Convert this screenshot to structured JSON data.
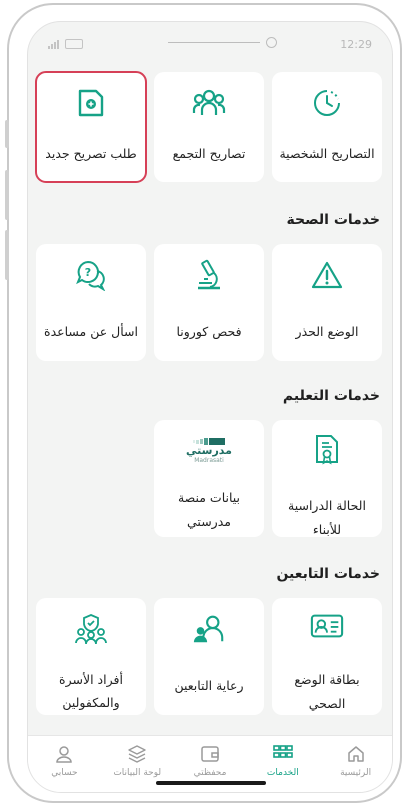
{
  "status": {
    "time": "12:29"
  },
  "colors": {
    "accent": "#16a287",
    "highlight": "#d64057",
    "background": "#f3f4f3"
  },
  "top_row": [
    {
      "label": "التصاريح الشخصية",
      "icon": "clock-icon"
    },
    {
      "label": "تصاريح التجمع",
      "icon": "group-icon"
    },
    {
      "label": "طلب تصريح جديد",
      "icon": "new-document-icon"
    }
  ],
  "health": {
    "title": "خدمات الصحة",
    "items": [
      {
        "label": "الوضع الحذر",
        "icon": "warning-icon"
      },
      {
        "label": "فحص كورونا",
        "icon": "microscope-icon"
      },
      {
        "label": "اسأل عن مساعدة",
        "icon": "help-chat-icon"
      }
    ]
  },
  "education": {
    "title": "خدمات التعليم",
    "items": [
      {
        "label": "الحالة الدراسية للأبناء",
        "icon": "certificate-icon"
      },
      {
        "label": "بيانات منصة مدرستي",
        "icon": "madrasati-logo"
      }
    ],
    "logo_text": "مدرستي",
    "logo_subtext": "Madrasati"
  },
  "dependents": {
    "title": "خدمات التابعين",
    "items": [
      {
        "label": "بطاقة الوضع الصحي",
        "icon": "id-card-icon"
      },
      {
        "label": "رعاية التابعين",
        "icon": "dependents-icon"
      },
      {
        "label": "أفراد الأسرة والمكفولين",
        "icon": "family-shield-icon"
      }
    ]
  },
  "tabbar": [
    {
      "label": "الرئيسية",
      "icon": "home-icon"
    },
    {
      "label": "الخدمات",
      "icon": "grid-icon",
      "active": true
    },
    {
      "label": "محفظتي",
      "icon": "wallet-icon"
    },
    {
      "label": "لوحة البيانات",
      "icon": "layers-icon"
    },
    {
      "label": "حسابي",
      "icon": "user-icon"
    }
  ]
}
